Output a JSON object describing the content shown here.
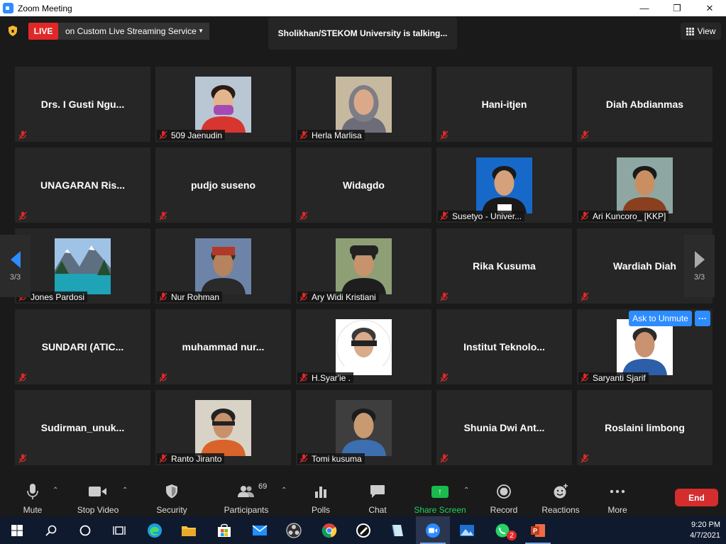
{
  "window": {
    "title": "Zoom Meeting",
    "controls": [
      "minimize",
      "maximize",
      "close"
    ]
  },
  "topbar": {
    "live_badge": "LIVE",
    "live_service": "on Custom Live Streaming Service",
    "talking": "Sholikhan/STEKOM University is talking...",
    "view_label": "View"
  },
  "tiles": [
    {
      "name": "Drs. I Gusti Ngu...",
      "has_video": false
    },
    {
      "name": "509 Jaenudin",
      "has_video": true
    },
    {
      "name": "Herla Marlisa",
      "has_video": true
    },
    {
      "name": "Hani-itjen",
      "has_video": false
    },
    {
      "name": "Diah Abdianmas",
      "has_video": false
    },
    {
      "name": "UNAGARAN Ris...",
      "has_video": false
    },
    {
      "name": "pudjo suseno",
      "has_video": false
    },
    {
      "name": "Widagdo",
      "has_video": false
    },
    {
      "name": "Susetyo - Univer...",
      "has_video": true
    },
    {
      "name": "Ari Kuncoro_ [KKP]",
      "has_video": true
    },
    {
      "name": "Jones Pardosi",
      "has_video": true
    },
    {
      "name": "Nur Rohman",
      "has_video": true
    },
    {
      "name": "Ary Widi Kristiani",
      "has_video": true
    },
    {
      "name": "Rika Kusuma",
      "has_video": false
    },
    {
      "name": "Wardiah Diah",
      "has_video": false
    },
    {
      "name": "SUNDARI (ATIC...",
      "has_video": false
    },
    {
      "name": "muhammad  nur...",
      "has_video": false
    },
    {
      "name": "H.Syar'ie .",
      "has_video": true
    },
    {
      "name": "Institut  Teknolo...",
      "has_video": false
    },
    {
      "name": "Saryanti Sjarif",
      "has_video": true
    },
    {
      "name": "Sudirman_unuk...",
      "has_video": false
    },
    {
      "name": "Ranto Jiranto",
      "has_video": true
    },
    {
      "name": "Tomi kusuma",
      "has_video": true
    },
    {
      "name": "Shunia Dwi Ant...",
      "has_video": false
    },
    {
      "name": "Roslaini limbong",
      "has_video": false
    }
  ],
  "pagination": {
    "left": "3/3",
    "right": "3/3"
  },
  "hover": {
    "ask_unmute": "Ask to Unmute",
    "more": "···"
  },
  "toolbar": {
    "mute": "Mute",
    "stop_video": "Stop Video",
    "security": "Security",
    "participants": "Participants",
    "participants_count": "69",
    "polls": "Polls",
    "chat": "Chat",
    "share_screen": "Share Screen",
    "record": "Record",
    "reactions": "Reactions",
    "more": "More",
    "end": "End"
  },
  "taskbar": {
    "icons": [
      "windows-start",
      "search",
      "cortana",
      "task-view",
      "edge",
      "file-explorer",
      "microsoft-store",
      "mail",
      "obs",
      "chrome",
      "inkscape",
      "notepad",
      "zoom",
      "photos",
      "whatsapp",
      "powerpoint"
    ],
    "whatsapp_badge": "2",
    "time": "9:20 PM",
    "date": "4/7/2021"
  },
  "colors": {
    "live": "#e02828",
    "accent": "#2d8cff",
    "share": "#1aba4c",
    "end": "#d32d2d",
    "mic_off": "#e02828"
  }
}
